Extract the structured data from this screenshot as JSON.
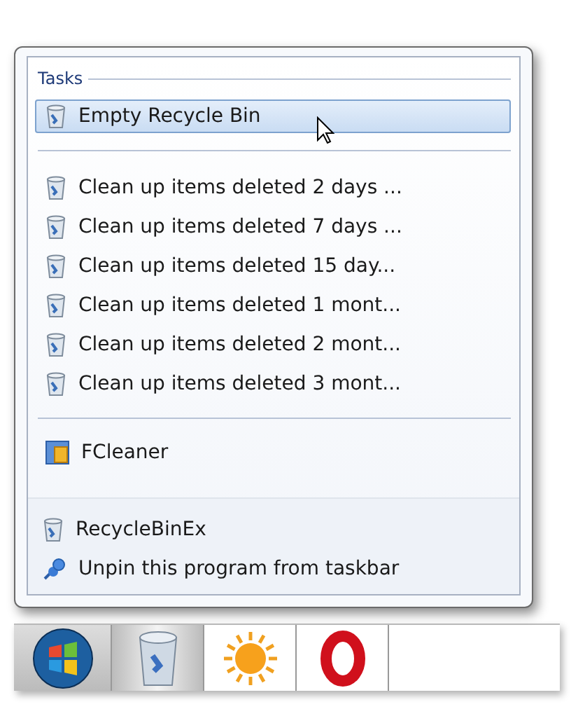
{
  "jump_list": {
    "sections": [
      {
        "title": "Tasks",
        "items": [
          {
            "label": "Empty Recycle Bin",
            "kind": "bin",
            "highlighted": true
          }
        ]
      },
      {
        "items": [
          {
            "label": "Clean up items deleted 2 days ...",
            "kind": "bin",
            "highlighted": false
          },
          {
            "label": "Clean up items deleted 7 days ...",
            "kind": "bin",
            "highlighted": false
          },
          {
            "label": "Clean up items deleted 15 day...",
            "kind": "bin",
            "highlighted": false
          },
          {
            "label": "Clean up items deleted 1 mont...",
            "kind": "bin",
            "highlighted": false
          },
          {
            "label": "Clean up items deleted 2 mont...",
            "kind": "bin",
            "highlighted": false
          },
          {
            "label": "Clean up items deleted 3 mont...",
            "kind": "bin",
            "highlighted": false
          }
        ]
      },
      {
        "items": [
          {
            "label": "FCleaner",
            "kind": "app",
            "highlighted": false
          }
        ]
      }
    ],
    "footer": [
      {
        "label": "RecycleBinEx",
        "kind": "bin"
      },
      {
        "label": "Unpin this program from taskbar",
        "kind": "pin"
      }
    ]
  },
  "taskbar": [
    {
      "kind": "start",
      "active": false
    },
    {
      "kind": "bin",
      "active": true
    },
    {
      "kind": "sun",
      "active": false
    },
    {
      "kind": "opera",
      "active": false
    }
  ]
}
